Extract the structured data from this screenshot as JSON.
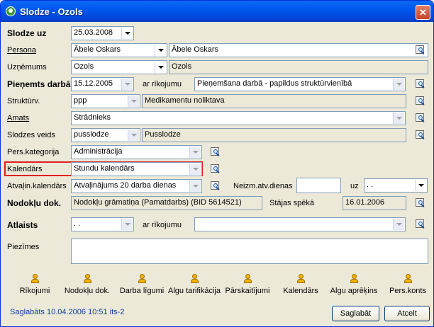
{
  "window": {
    "title": "Slodze - Ozols",
    "close_symbol": "✕"
  },
  "labels": {
    "slodze_uz": "Slodze uz",
    "persona": "Persona",
    "uznemums": "Uzņēmums",
    "pienemts_darba": "Pieņemts darbā",
    "ar_rikojumu": "ar rīkojumu",
    "strukturv": "Struktūrv.",
    "amats": "Amats",
    "slodzes_veids": "Slodzes veids",
    "pers_kategorija": "Pers.kategorija",
    "kalendars": "Kalendārs",
    "atvalin_kalendars": "Atvaļin.kalendārs",
    "neizm_atv_dienas": "Neizm.atv.dienas",
    "uz": "uz",
    "nodoklu_dok": "Nodokļu dok.",
    "stajas_speka": "Stājas spēkā",
    "atlaists": "Atlaists",
    "ar_rikojumu2": "ar rīkojumu",
    "piezimes": "Piezīmes"
  },
  "fields": {
    "slodze_uz": "25.03.2008",
    "persona_code": "Ābele Oskars",
    "persona_name": "Ābele Oskars",
    "uznemums_code": "Ozols",
    "uznemums_name": "Ozols",
    "pienemts_date": "15.12.2005",
    "pienemts_rikojums": "Pieņemšana darbā - papildus struktūrvienībā",
    "strukturv_code": "ppp",
    "strukturv_name": "Medikamentu noliktava",
    "amats": "Strādnieks",
    "slodzes_veids_code": "pusslodze",
    "slodzes_veids_name": "Pusslodze",
    "pers_kategorija": "Administrācija",
    "kalendars": "Stundu kalendārs",
    "atvalin_kalendars": "Atvaļinājums 20 darba dienas",
    "neizm_atv_dienas": "",
    "uz_date": " .  .",
    "nodoklu_dok": "Nodokļu grāmatiņa (Pamatdarbs) (BID 5614521)",
    "stajas_speka": "16.01.2006",
    "atlaists_date": " .  .",
    "atlaists_rikojums": "",
    "piezimes": ""
  },
  "toolbar": [
    {
      "label": "Rīkojumi",
      "icon": "person-icon"
    },
    {
      "label": "Nodokļu dok.",
      "icon": "person-icon"
    },
    {
      "label": "Darba līgumi",
      "icon": "person-icon"
    },
    {
      "label": "Algu tarifikācija",
      "icon": "person-icon"
    },
    {
      "label": "Pārskaitījumi",
      "icon": "person-icon"
    },
    {
      "label": "Kalendārs",
      "icon": "person-icon"
    },
    {
      "label": "Algu aprēķins",
      "icon": "person-icon"
    },
    {
      "label": "Pers.konts",
      "icon": "person-icon"
    }
  ],
  "status": "Saglabāts 10.04.2006 10:51 its-2",
  "buttons": {
    "save": "Saglabāt",
    "cancel": "Atcelt"
  },
  "colors": {
    "title_bar": "#0058ee",
    "highlight_border": "#e02020",
    "status_text": "#0b3e9e"
  }
}
